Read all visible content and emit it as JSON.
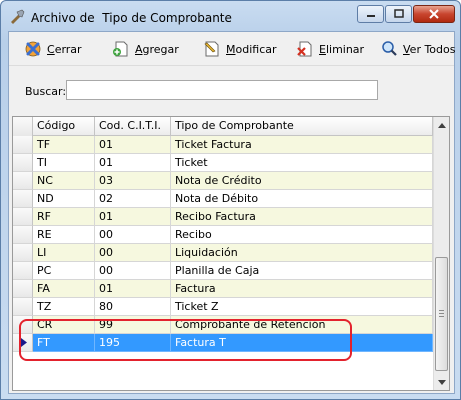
{
  "window": {
    "title": "Archivo de  Tipo de Comprobante"
  },
  "toolbar": {
    "close_label_first": "C",
    "close_label_rest": "errar",
    "add_label_first": "A",
    "add_label_rest": "gregar",
    "edit_label_first": "M",
    "edit_label_rest": "odificar",
    "delete_label_first": "E",
    "delete_label_rest": "liminar",
    "viewall_label_first": "V",
    "viewall_label_rest": "er Todos"
  },
  "search": {
    "label": "Buscar:",
    "value": ""
  },
  "grid": {
    "columns": [
      "Código",
      "Cod. C.I.T.I.",
      "Tipo de Comprobante"
    ],
    "rows": [
      {
        "codigo": "TF",
        "citi": "01",
        "tipo": "Ticket Factura"
      },
      {
        "codigo": "TI",
        "citi": "01",
        "tipo": "Ticket"
      },
      {
        "codigo": "NC",
        "citi": "03",
        "tipo": "Nota de Crédito"
      },
      {
        "codigo": "ND",
        "citi": "02",
        "tipo": "Nota de Débito"
      },
      {
        "codigo": "RF",
        "citi": "01",
        "tipo": "Recibo Factura"
      },
      {
        "codigo": "RE",
        "citi": "00",
        "tipo": "Recibo"
      },
      {
        "codigo": "LI",
        "citi": "00",
        "tipo": "Liquidación"
      },
      {
        "codigo": "PC",
        "citi": "00",
        "tipo": "Planilla de Caja"
      },
      {
        "codigo": "FA",
        "citi": "01",
        "tipo": "Factura"
      },
      {
        "codigo": "TZ",
        "citi": "80",
        "tipo": "Ticket Z"
      },
      {
        "codigo": "CR",
        "citi": "99",
        "tipo": "Comprobante de Retención"
      },
      {
        "codigo": "FT",
        "citi": "195",
        "tipo": "Factura T"
      }
    ],
    "selected_index": 11
  },
  "colors": {
    "selection": "#3399ff",
    "alt_row": "#f6f8df",
    "highlight": "#e3222d"
  }
}
